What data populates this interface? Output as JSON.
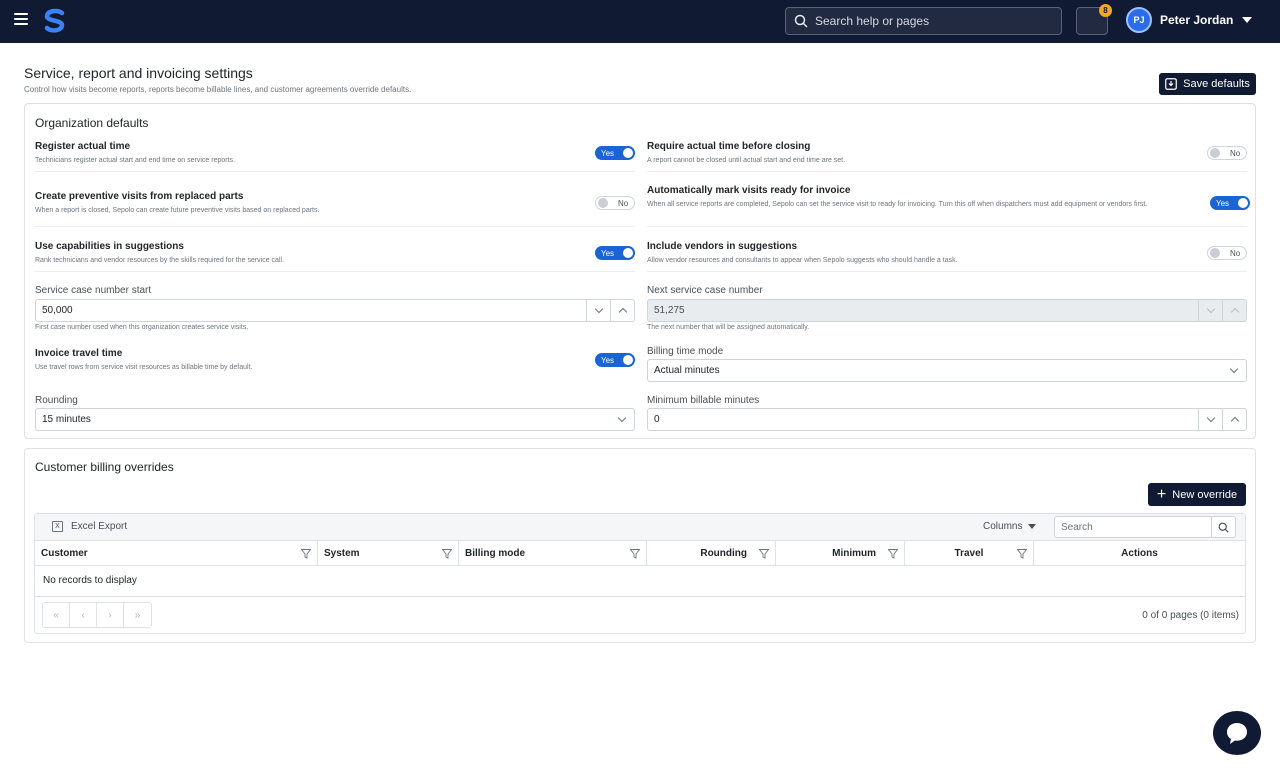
{
  "header": {
    "search_placeholder": "Search help or pages",
    "notification_count": "8",
    "user_initials": "PJ",
    "user_name": "Peter Jordan"
  },
  "page": {
    "title": "Service, report and invoicing settings",
    "subtitle": "Control how visits become reports, reports become billable lines, and customer agreements override defaults.",
    "save_label": "Save defaults"
  },
  "org": {
    "title": "Organization defaults",
    "register_time": {
      "label": "Register actual time",
      "desc": "Technicians register actual start and end time on service reports.",
      "state": "Yes"
    },
    "require_time": {
      "label": "Require actual time before closing",
      "desc": "A report cannot be closed until actual start and end time are set.",
      "state": "No"
    },
    "preventive": {
      "label": "Create preventive visits from replaced parts",
      "desc": "When a report is closed, Sepolo can create future preventive visits based on replaced parts.",
      "state": "No"
    },
    "auto_ready": {
      "label": "Automatically mark visits ready for invoice",
      "desc": "When all service reports are completed, Sepolo can set the service visit to ready for invoicing. Turn this off when dispatchers must add equipment or vendors first.",
      "state": "Yes"
    },
    "capabilities": {
      "label": "Use capabilities in suggestions",
      "desc": "Rank technicians and vendor resources by the skills required for the service call.",
      "state": "Yes"
    },
    "vendors": {
      "label": "Include vendors in suggestions",
      "desc": "Allow vendor resources and consultants to appear when Sepolo suggests who should handle a task.",
      "state": "No"
    },
    "case_start": {
      "label": "Service case number start",
      "value": "50,000",
      "help": "First case number used when this organization creates service visits."
    },
    "next_case": {
      "label": "Next service case number",
      "value": "51,275",
      "help": "The next number that will be assigned automatically."
    },
    "travel": {
      "label": "Invoice travel time",
      "desc": "Use travel rows from service visit resources as billable time by default.",
      "state": "Yes"
    },
    "billing_mode": {
      "label": "Billing time mode",
      "value": "Actual minutes"
    },
    "rounding": {
      "label": "Rounding",
      "value": "15 minutes"
    },
    "min_minutes": {
      "label": "Minimum billable minutes",
      "value": "0"
    }
  },
  "overrides": {
    "title": "Customer billing overrides",
    "new_label": "New override",
    "excel_label": "Excel Export",
    "columns_label": "Columns",
    "search_placeholder": "Search",
    "headers": [
      "Customer",
      "System",
      "Billing mode",
      "Rounding",
      "Minimum",
      "Travel",
      "Actions"
    ],
    "empty_text": "No records to display",
    "pager": [
      "«",
      "‹",
      "›",
      "»"
    ],
    "pager_info": "0 of 0 pages (0 items)"
  },
  "colors": {
    "navy": "#111a33",
    "accent": "#1a64d6",
    "badge": "#f5a623"
  }
}
